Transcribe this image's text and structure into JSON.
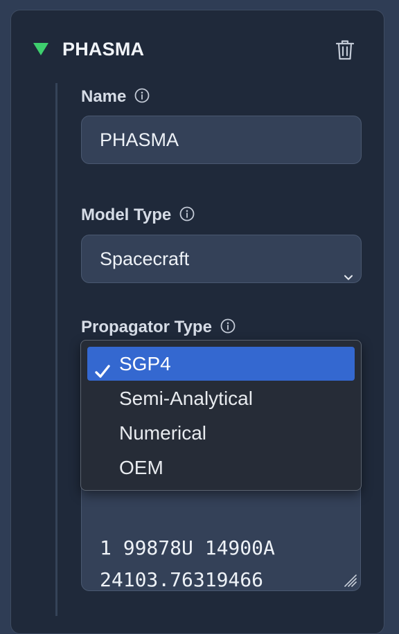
{
  "header": {
    "title": "PHASMA",
    "toggle_icon": "triangle-down-icon",
    "toggle_color": "#3ecf6e",
    "delete_icon": "trash-icon"
  },
  "fields": {
    "name": {
      "label": "Name",
      "value": "PHASMA",
      "info_icon": "info-icon"
    },
    "model_type": {
      "label": "Model Type",
      "value": "Spacecraft",
      "info_icon": "info-icon"
    },
    "propagator_type": {
      "label": "Propagator Type",
      "info_icon": "info-icon"
    }
  },
  "propagator_dropdown": {
    "selected_color": "#3468d0",
    "options": [
      {
        "label": "SGP4",
        "selected": true
      },
      {
        "label": "Semi-Analytical",
        "selected": false
      },
      {
        "label": "Numerical",
        "selected": false
      },
      {
        "label": "OEM",
        "selected": false
      }
    ]
  },
  "tle_text": {
    "lines": [
      "1 99878U 14900A",
      "24103.76319466"
    ]
  }
}
